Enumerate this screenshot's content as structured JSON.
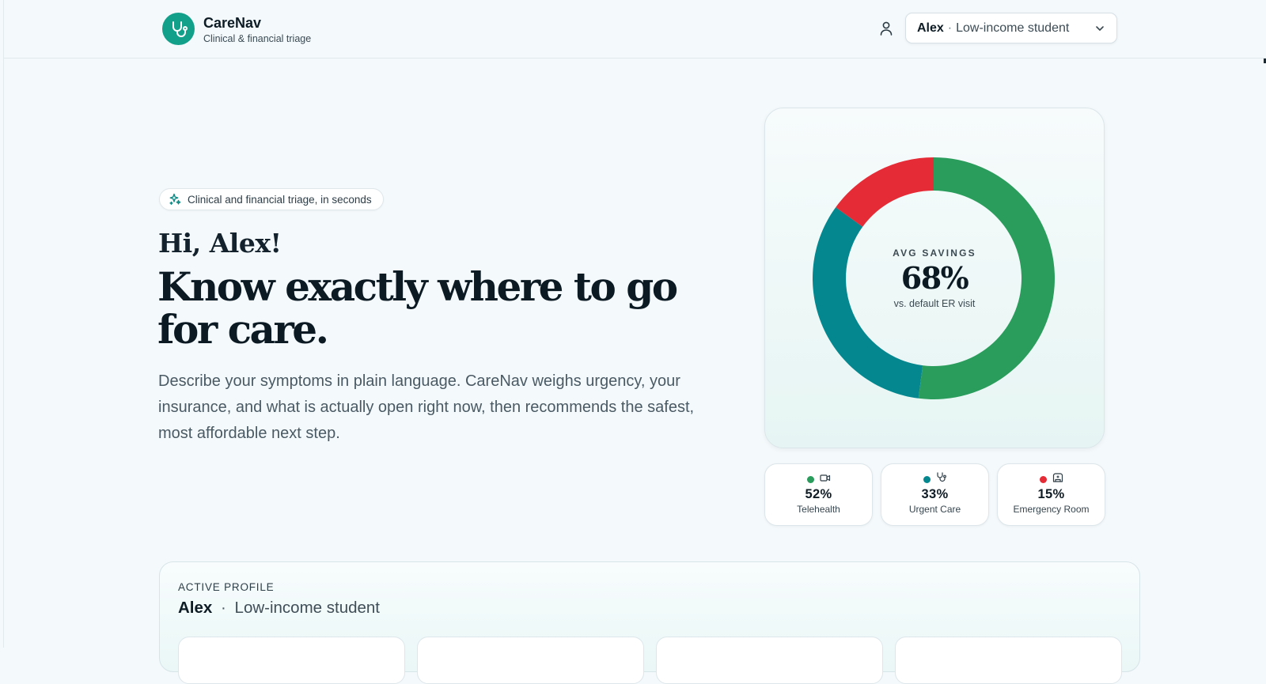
{
  "header": {
    "brand_name": "CareNav",
    "brand_subtitle": "Clinical & financial triage",
    "profile_select": {
      "name": "Alex",
      "separator": "·",
      "role": "Low-income student"
    }
  },
  "hero": {
    "badge": "Clinical and financial triage, in seconds",
    "greeting": "Hi, Alex!",
    "headline": "Know exactly where to go for care.",
    "description": "Describe your symptoms in plain language. CareNav weighs urgency, your insurance, and what is actually open right now, then recommends the safest, most affordable next step."
  },
  "savings": {
    "label": "AVG SAVINGS",
    "value": "68%",
    "note": "vs. default ER visit"
  },
  "chart_data": {
    "type": "pie",
    "categories": [
      "Telehealth",
      "Urgent Care",
      "Emergency Room"
    ],
    "values": [
      52,
      33,
      15
    ],
    "colors": [
      "#2a9d5c",
      "#04878e",
      "#e52b36"
    ]
  },
  "stats": [
    {
      "pct": "52%",
      "label": "Telehealth",
      "color": "#2a9d5c",
      "icon": "video-camera-icon"
    },
    {
      "pct": "33%",
      "label": "Urgent Care",
      "color": "#04878e",
      "icon": "stethoscope-icon"
    },
    {
      "pct": "15%",
      "label": "Emergency Room",
      "color": "#e52b36",
      "icon": "ambulance-icon"
    }
  ],
  "active_profile": {
    "label": "ACTIVE PROFILE",
    "name": "Alex",
    "separator": "·",
    "role": "Low-income student"
  },
  "colors": {
    "brand": "#12a08b",
    "background": "#f4f9fb"
  }
}
